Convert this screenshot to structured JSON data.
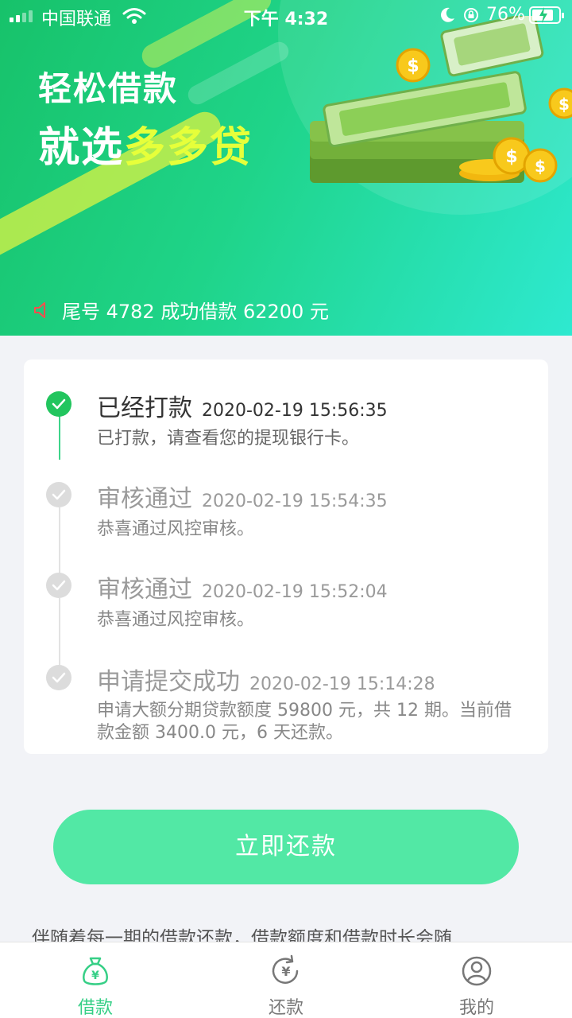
{
  "status_bar": {
    "carrier": "中国联通",
    "time": "下午 4:32",
    "battery_percent": "76%"
  },
  "banner": {
    "headline_line1": "轻松借款",
    "headline_line2_prefix": "就选",
    "headline_line2_brand": "多多贷",
    "ticker_text": "尾号 4782 成功借款 62200 元"
  },
  "timeline": [
    {
      "title": "已经打款",
      "time": "2020-02-19 15:56:35",
      "desc": "已打款，请查看您的提现银行卡。",
      "active": true
    },
    {
      "title": "审核通过",
      "time": "2020-02-19 15:54:35",
      "desc": "恭喜通过风控审核。",
      "active": false
    },
    {
      "title": "审核通过",
      "time": "2020-02-19 15:52:04",
      "desc": "恭喜通过风控审核。",
      "active": false
    },
    {
      "title": "申请提交成功",
      "time": "2020-02-19 15:14:28",
      "desc": "申请大额分期贷款额度 59800 元，共 12 期。当前借款金额 3400.0 元，6 天还款。",
      "active": false
    }
  ],
  "repay_button_label": "立即还款",
  "notice_text": "伴随着每一期的借款还款，借款额度和借款时长会随",
  "tabs": [
    {
      "label": "借款",
      "icon": "money-bag-icon",
      "active": true
    },
    {
      "label": "还款",
      "icon": "repay-cycle-icon",
      "active": false
    },
    {
      "label": "我的",
      "icon": "user-icon",
      "active": false
    }
  ],
  "colors": {
    "accent": "#36cf86",
    "button": "#52e8a5",
    "brand_text": "#e6ff3a"
  }
}
